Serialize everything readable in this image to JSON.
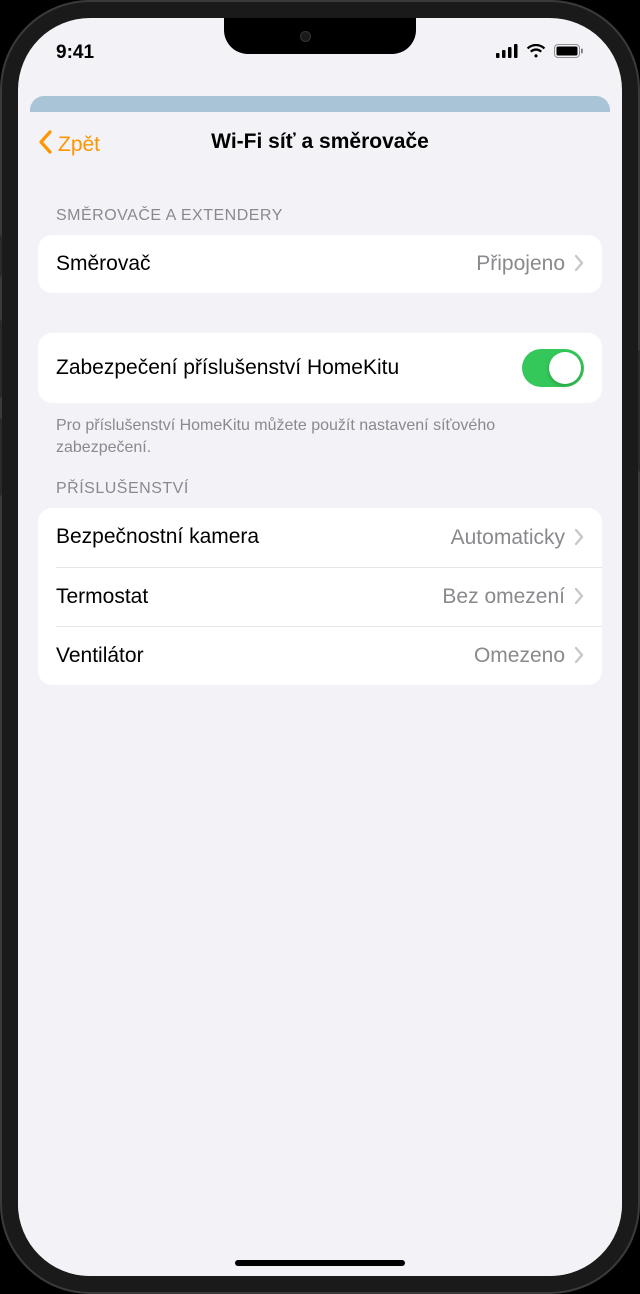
{
  "status": {
    "time": "9:41"
  },
  "nav": {
    "back": "Zpět",
    "title": "Wi-Fi síť a směrovače"
  },
  "section_routers": {
    "header": "SMĚROVAČE A EXTENDERY",
    "items": [
      {
        "label": "Směrovač",
        "detail": "Připojeno"
      }
    ]
  },
  "section_security": {
    "toggle_label": "Zabezpečení příslušenství HomeKitu",
    "footer": "Pro příslušenství HomeKitu můžete použít nastavení síťového zabezpečení."
  },
  "section_accessories": {
    "header": "PŘÍSLUŠENSTVÍ",
    "items": [
      {
        "label": "Bezpečnostní kamera",
        "detail": "Automaticky"
      },
      {
        "label": "Termostat",
        "detail": "Bez omezení"
      },
      {
        "label": "Ventilátor",
        "detail": "Omezeno"
      }
    ]
  }
}
